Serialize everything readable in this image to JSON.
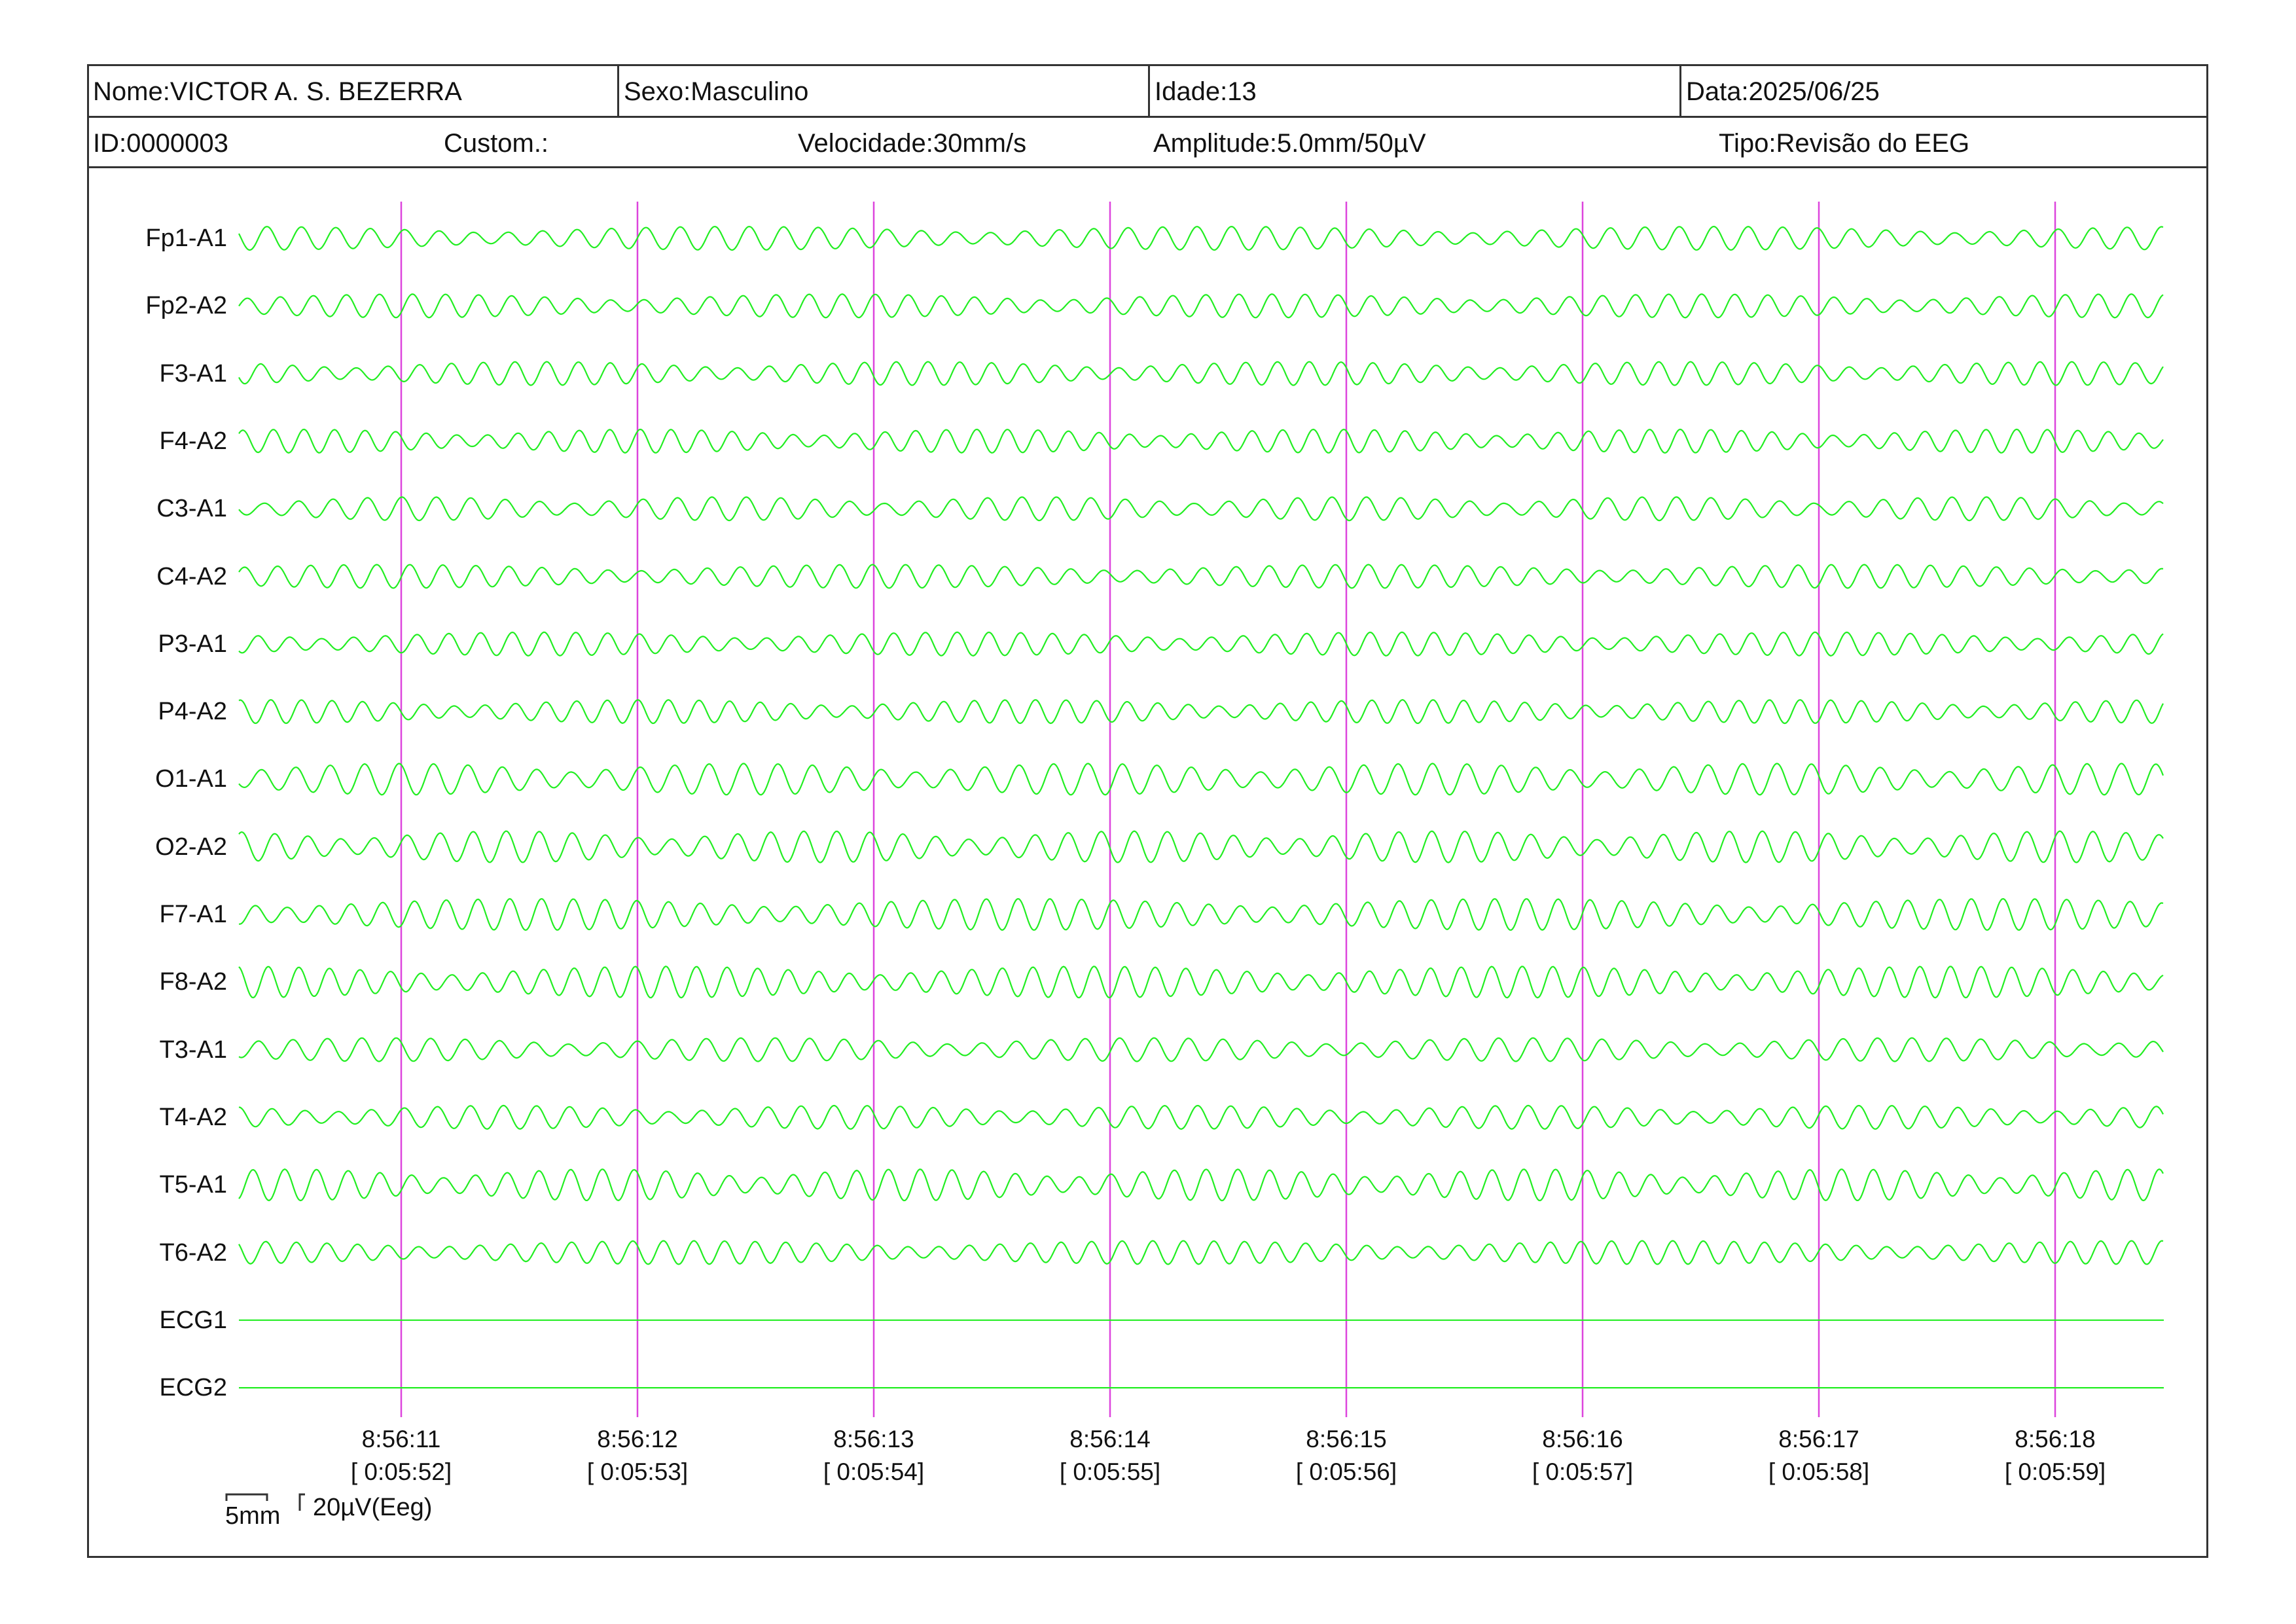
{
  "header": {
    "name": "Nome:VICTOR A. S. BEZERRA",
    "sex": "Sexo:Masculino",
    "age": "Idade:13",
    "date": "Data:2025/06/25",
    "id": "ID:0000003",
    "custom": "Custom.:",
    "speed": "Velocidade:30mm/s",
    "amplitude": "Amplitude:5.0mm/50µV",
    "type": "Tipo:Revisão do EEG"
  },
  "channels": [
    {
      "label": "Fp1-A1",
      "kind": "eeg"
    },
    {
      "label": "Fp2-A2",
      "kind": "eeg"
    },
    {
      "label": "F3-A1",
      "kind": "eeg"
    },
    {
      "label": "F4-A2",
      "kind": "eeg"
    },
    {
      "label": "C3-A1",
      "kind": "eeg"
    },
    {
      "label": "C4-A2",
      "kind": "eeg"
    },
    {
      "label": "P3-A1",
      "kind": "eeg"
    },
    {
      "label": "P4-A2",
      "kind": "eeg"
    },
    {
      "label": "O1-A1",
      "kind": "eeg"
    },
    {
      "label": "O2-A2",
      "kind": "eeg"
    },
    {
      "label": "F7-A1",
      "kind": "eeg"
    },
    {
      "label": "F8-A2",
      "kind": "eeg"
    },
    {
      "label": "T3-A1",
      "kind": "eeg"
    },
    {
      "label": "T4-A2",
      "kind": "eeg"
    },
    {
      "label": "T5-A1",
      "kind": "eeg"
    },
    {
      "label": "T6-A2",
      "kind": "eeg"
    },
    {
      "label": "ECG1",
      "kind": "flat"
    },
    {
      "label": "ECG2",
      "kind": "flat"
    }
  ],
  "time_marks": [
    {
      "clock": "8:56:11",
      "elapsed": "[ 0:05:52]"
    },
    {
      "clock": "8:56:12",
      "elapsed": "[ 0:05:53]"
    },
    {
      "clock": "8:56:13",
      "elapsed": "[ 0:05:54]"
    },
    {
      "clock": "8:56:14",
      "elapsed": "[ 0:05:55]"
    },
    {
      "clock": "8:56:15",
      "elapsed": "[ 0:05:56]"
    },
    {
      "clock": "8:56:16",
      "elapsed": "[ 0:05:57]"
    },
    {
      "clock": "8:56:17",
      "elapsed": "[ 0:05:58]"
    },
    {
      "clock": "8:56:18",
      "elapsed": "[ 0:05:59]"
    }
  ],
  "scale": {
    "time": "5mm",
    "amplitude": "20µV(Eeg)"
  },
  "colors": {
    "trace": "#22ee22",
    "marker": "#dd44dd",
    "border": "#333333"
  }
}
